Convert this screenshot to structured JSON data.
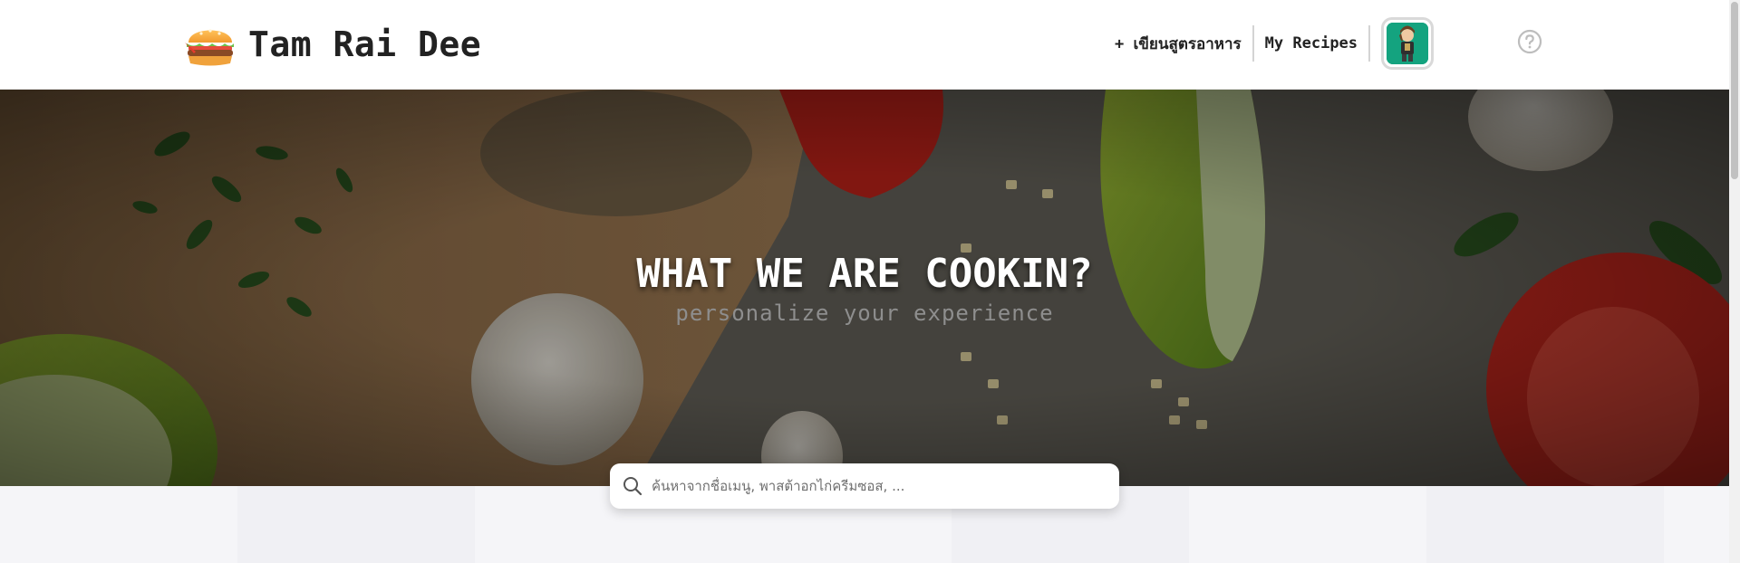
{
  "header": {
    "brand_name": "Tam Rai Dee",
    "brand_logo_icon": "hamburger-icon",
    "nav": {
      "write_recipe_label": "+ เขียนสูตรอาหาร",
      "my_recipes_label": "My Recipes"
    },
    "avatar_icon": "user-avatar-icon",
    "help_icon": "question-circle-icon"
  },
  "hero": {
    "title": "WHAT WE ARE COOKIN?",
    "subtitle": "personalize your experience"
  },
  "search": {
    "placeholder": "ค้นหาจากชื่อเมนู, พาสต้าอกไก่ครีมซอส, ...",
    "value": ""
  },
  "colors": {
    "accent_avatar": "#14a37f",
    "hero_overlay": "#595650",
    "text_dark": "#222222"
  }
}
